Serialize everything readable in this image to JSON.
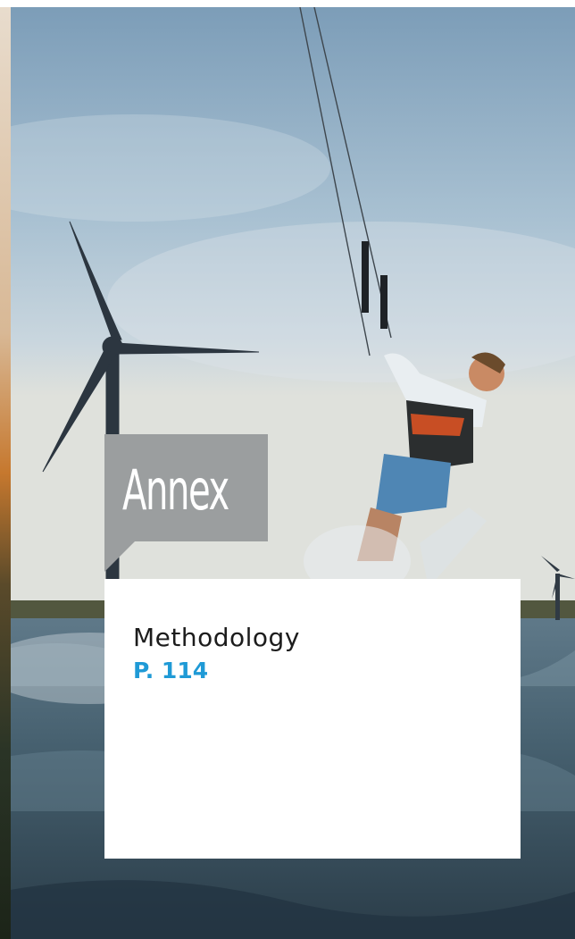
{
  "section": {
    "label": "Annex",
    "color": "#9b9e9f"
  },
  "entry": {
    "title": "Methodology",
    "page_ref": "P. 114",
    "page_ref_color": "#1f9ad6"
  },
  "photo": {
    "subject": "kitesurfer-wind-turbines"
  }
}
